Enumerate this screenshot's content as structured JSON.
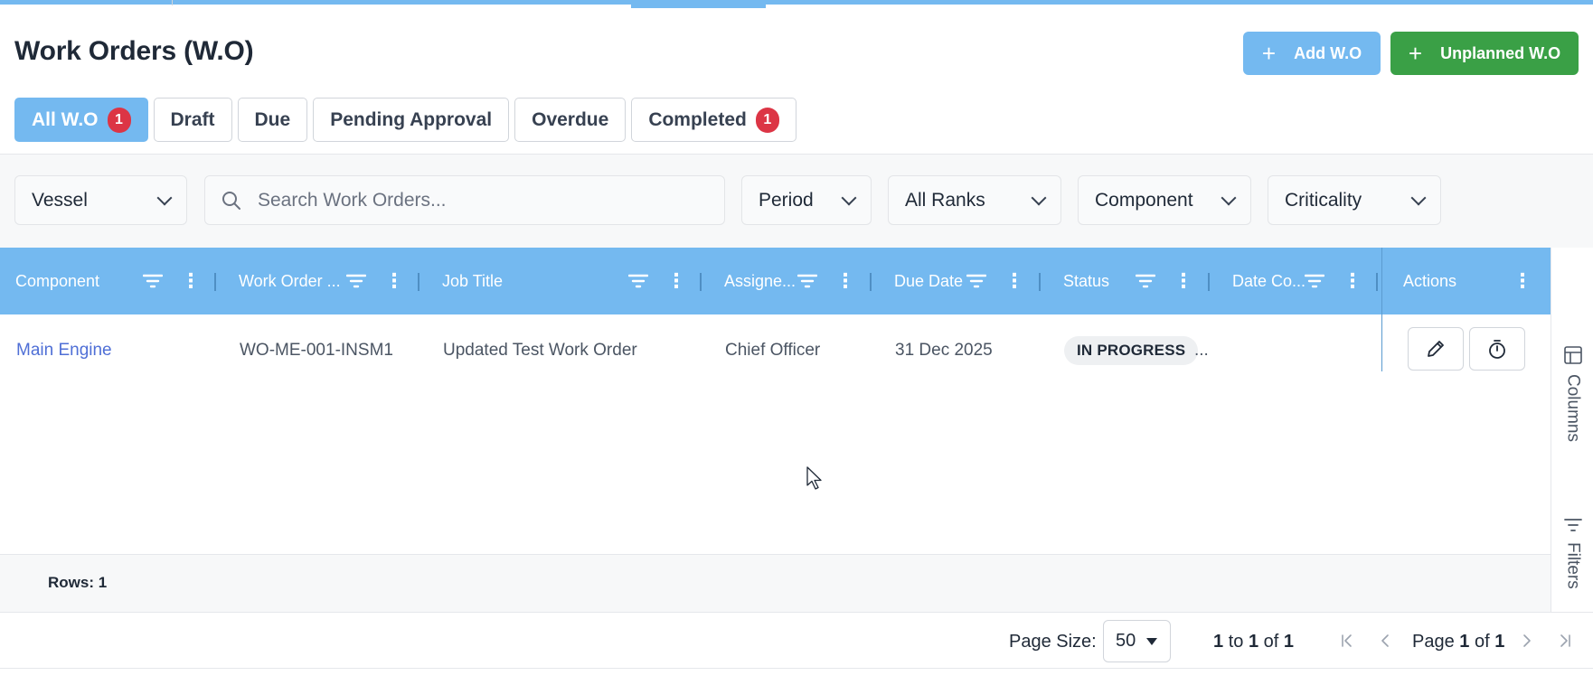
{
  "header": {
    "title": "Work Orders (W.O)",
    "add_button": "Add W.O",
    "unplanned_button": "Unplanned W.O"
  },
  "tabs": [
    {
      "label": "All W.O",
      "badge": "1",
      "active": true
    },
    {
      "label": "Draft"
    },
    {
      "label": "Due"
    },
    {
      "label": "Pending Approval"
    },
    {
      "label": "Overdue"
    },
    {
      "label": "Completed",
      "badge": "1"
    }
  ],
  "filters": {
    "vessel": "Vessel",
    "search_placeholder": "Search Work Orders...",
    "period": "Period",
    "ranks": "All Ranks",
    "component": "Component",
    "criticality": "Criticality"
  },
  "grid": {
    "columns": [
      "Component",
      "Work Order ...",
      "Job Title",
      "Assigne...",
      "Due Date",
      "Status",
      "Date Co...",
      "Actions"
    ],
    "rows": [
      {
        "component": "Main Engine",
        "work_order": "WO-ME-001-INSM1",
        "job_title": "Updated Test Work Order",
        "assignee": "Chief Officer",
        "due_date": "31 Dec 2025",
        "status": "IN PROGRESS",
        "date_completed": "..."
      }
    ]
  },
  "side_panel": {
    "columns_label": "Columns",
    "filters_label": "Filters"
  },
  "status_bar": {
    "rows_label": "Rows: 1"
  },
  "pagination": {
    "page_size_label": "Page Size:",
    "page_size": "50",
    "range_from": "1",
    "range_to_word": "to",
    "range_to": "1",
    "range_of_word": "of",
    "range_total": "1",
    "page_word": "Page",
    "page_current": "1",
    "page_of_word": "of",
    "page_total": "1"
  },
  "colors": {
    "primary": "#74b9f0",
    "success": "#3aa046",
    "badge": "#dc3545",
    "link": "#4f6fd6"
  }
}
